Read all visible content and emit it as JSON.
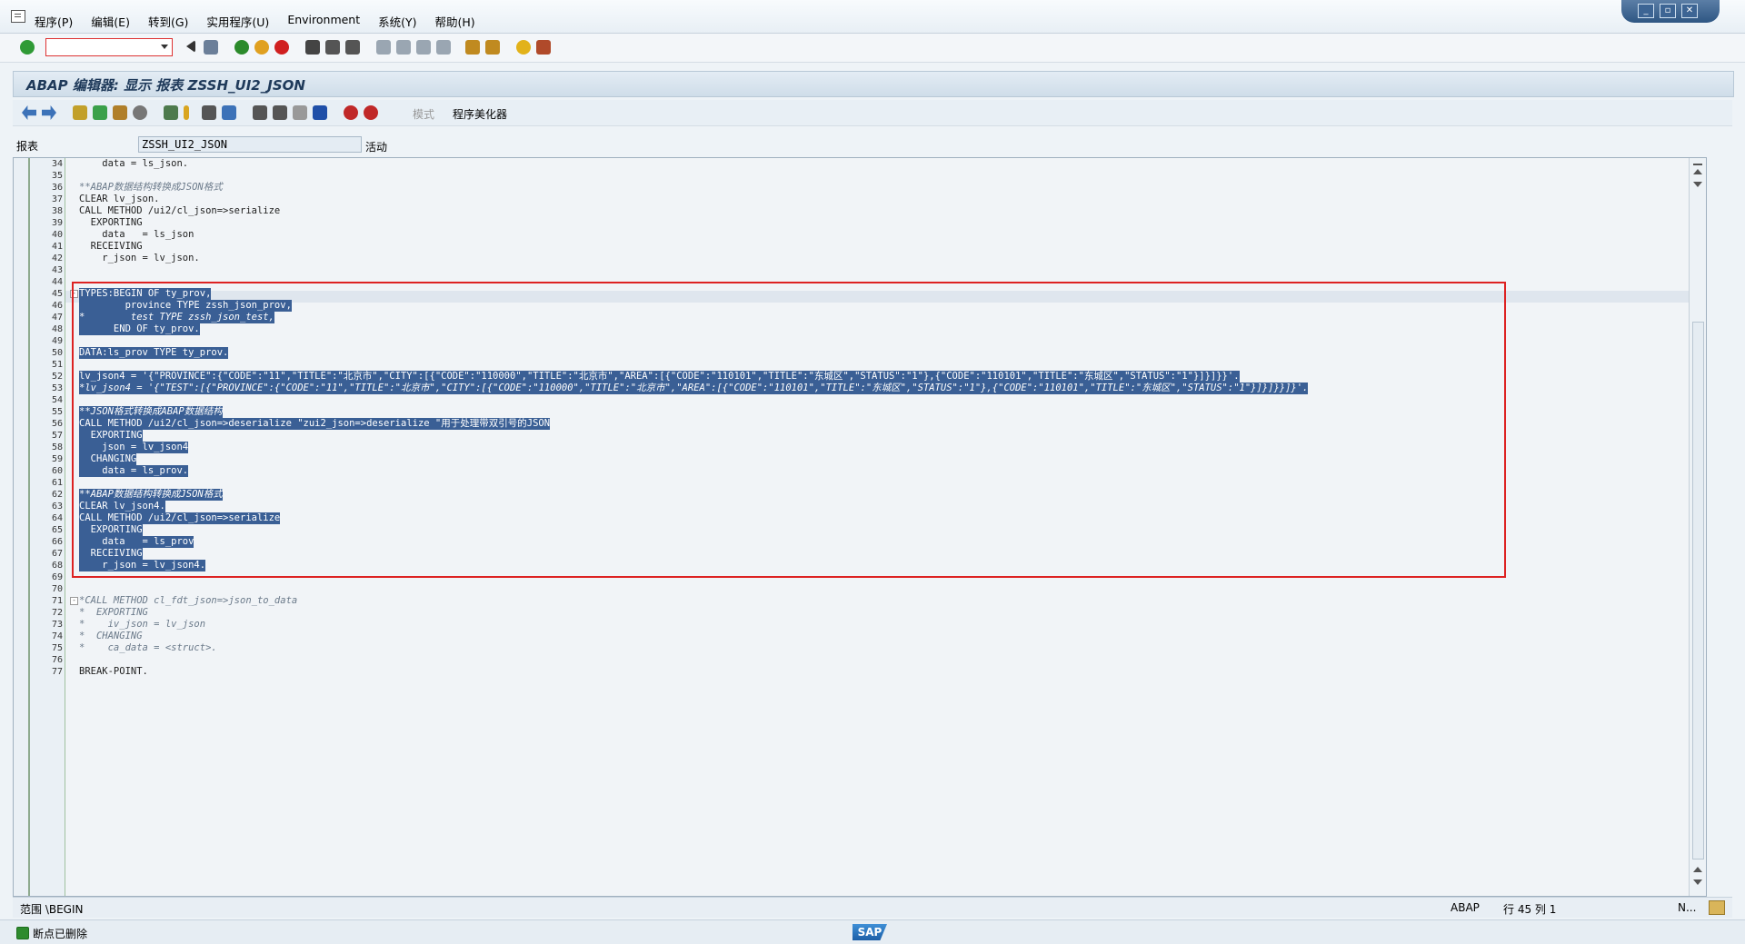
{
  "menu": {
    "items": [
      "程序(P)",
      "编辑(E)",
      "转到(G)",
      "实用程序(U)",
      "Environment",
      "系统(Y)",
      "帮助(H)"
    ]
  },
  "window_controls": [
    "_",
    "▫",
    "✕"
  ],
  "title": "ABAP 编辑器: 显示 报表 ZSSH_UI2_JSON",
  "app_toolbar": {
    "mode_label": "模式",
    "beautifier_label": "程序美化器"
  },
  "report": {
    "label": "报表",
    "value": "ZSSH_UI2_JSON",
    "status": "活动"
  },
  "code_lines": [
    {
      "n": "34",
      "t": "    data = ls_json."
    },
    {
      "n": "35",
      "t": ""
    },
    {
      "n": "36",
      "t": "**ABAP数据结构转换成JSON格式"
    },
    {
      "n": "37",
      "t": "CLEAR lv_json."
    },
    {
      "n": "38",
      "t": "CALL METHOD /ui2/cl_json=>serialize"
    },
    {
      "n": "39",
      "t": "  EXPORTING"
    },
    {
      "n": "40",
      "t": "    data   = ls_json"
    },
    {
      "n": "41",
      "t": "  RECEIVING"
    },
    {
      "n": "42",
      "t": "    r_json = lv_json."
    },
    {
      "n": "43",
      "t": ""
    },
    {
      "n": "44",
      "t": ""
    },
    {
      "n": "45",
      "t": "TYPES:BEGIN OF ty_prov,"
    },
    {
      "n": "46",
      "t": "        province TYPE zssh_json_prov,"
    },
    {
      "n": "47",
      "t": "*        test TYPE zssh_json_test,"
    },
    {
      "n": "48",
      "t": "      END OF ty_prov."
    },
    {
      "n": "49",
      "t": ""
    },
    {
      "n": "50",
      "t": "DATA:ls_prov TYPE ty_prov."
    },
    {
      "n": "51",
      "t": ""
    },
    {
      "n": "52",
      "t": "lv_json4 = '{\"PROVINCE\":{\"CODE\":\"11\",\"TITLE\":\"北京市\",\"CITY\":[{\"CODE\":\"110000\",\"TITLE\":\"北京市\",\"AREA\":[{\"CODE\":\"110101\",\"TITLE\":\"东城区\",\"STATUS\":\"1\"},{\"CODE\":\"110101\",\"TITLE\":\"东城区\",\"STATUS\":\"1\"}]}]}}'."
    },
    {
      "n": "53",
      "t": "*lv_json4 = '{\"TEST\":[{\"PROVINCE\":{\"CODE\":\"11\",\"TITLE\":\"北京市\",\"CITY\":[{\"CODE\":\"110000\",\"TITLE\":\"北京市\",\"AREA\":[{\"CODE\":\"110101\",\"TITLE\":\"东城区\",\"STATUS\":\"1\"},{\"CODE\":\"110101\",\"TITLE\":\"东城区\",\"STATUS\":\"1\"}]}]}}]}'."
    },
    {
      "n": "54",
      "t": ""
    },
    {
      "n": "55",
      "t": "**JSON格式转换成ABAP数据结构"
    },
    {
      "n": "56",
      "t": "CALL METHOD /ui2/cl_json=>deserialize \"zui2_json=>deserialize \"用于处理带双引号的JSON"
    },
    {
      "n": "57",
      "t": "  EXPORTING"
    },
    {
      "n": "58",
      "t": "    json = lv_json4"
    },
    {
      "n": "59",
      "t": "  CHANGING"
    },
    {
      "n": "60",
      "t": "    data = ls_prov."
    },
    {
      "n": "61",
      "t": ""
    },
    {
      "n": "62",
      "t": "**ABAP数据结构转换成JSON格式"
    },
    {
      "n": "63",
      "t": "CLEAR lv_json4."
    },
    {
      "n": "64",
      "t": "CALL METHOD /ui2/cl_json=>serialize"
    },
    {
      "n": "65",
      "t": "  EXPORTING"
    },
    {
      "n": "66",
      "t": "    data   = ls_prov"
    },
    {
      "n": "67",
      "t": "  RECEIVING"
    },
    {
      "n": "68",
      "t": "    r_json = lv_json4."
    },
    {
      "n": "69",
      "t": ""
    },
    {
      "n": "70",
      "t": ""
    },
    {
      "n": "71",
      "t": "*CALL METHOD cl_fdt_json=>json_to_data"
    },
    {
      "n": "72",
      "t": "*  EXPORTING"
    },
    {
      "n": "73",
      "t": "*    iv_json = lv_json"
    },
    {
      "n": "74",
      "t": "*  CHANGING"
    },
    {
      "n": "75",
      "t": "*    ca_data = <struct>."
    },
    {
      "n": "76",
      "t": ""
    },
    {
      "n": "77",
      "t": "BREAK-POINT."
    }
  ],
  "editor_status": {
    "scope": "范围 \\BEGIN",
    "lang": "ABAP",
    "position": "行 45 列  1",
    "mode": "N..."
  },
  "message": "断点已删除",
  "sap_logo": "SAP"
}
